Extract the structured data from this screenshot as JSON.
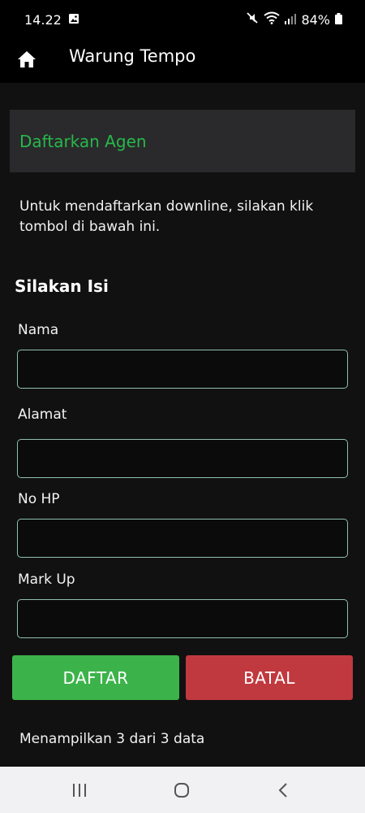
{
  "status_bar": {
    "time": "14.22",
    "battery": "84%"
  },
  "app_bar": {
    "title": "Warung Tempo"
  },
  "section": {
    "title": "Daftarkan Agen"
  },
  "info_text": "Untuk mendaftarkan downline, silakan klik tombol di bawah ini.",
  "form": {
    "heading": "Silakan Isi",
    "fields": [
      {
        "label": "Nama",
        "value": "",
        "placeholder": ""
      },
      {
        "label": "Alamat",
        "value": "",
        "placeholder": ""
      },
      {
        "label": "No HP",
        "value": "",
        "placeholder": ""
      },
      {
        "label": "Mark Up",
        "value": "",
        "placeholder": ""
      }
    ]
  },
  "buttons": {
    "daftar": "DAFTAR",
    "batal": "BATAL"
  },
  "footer_text": "Menampilkan 3 dari 3 data",
  "colors": {
    "accent_green": "#27b84a",
    "button_green": "#3cb34a",
    "button_red": "#c0393e"
  },
  "icons": {
    "home": "home-icon",
    "image": "image-icon",
    "mute": "mute-icon",
    "wifi": "wifi-icon",
    "signal": "signal-icon",
    "battery": "battery-icon",
    "recents": "recents-icon",
    "home_nav": "home-nav-icon",
    "back": "back-icon"
  }
}
